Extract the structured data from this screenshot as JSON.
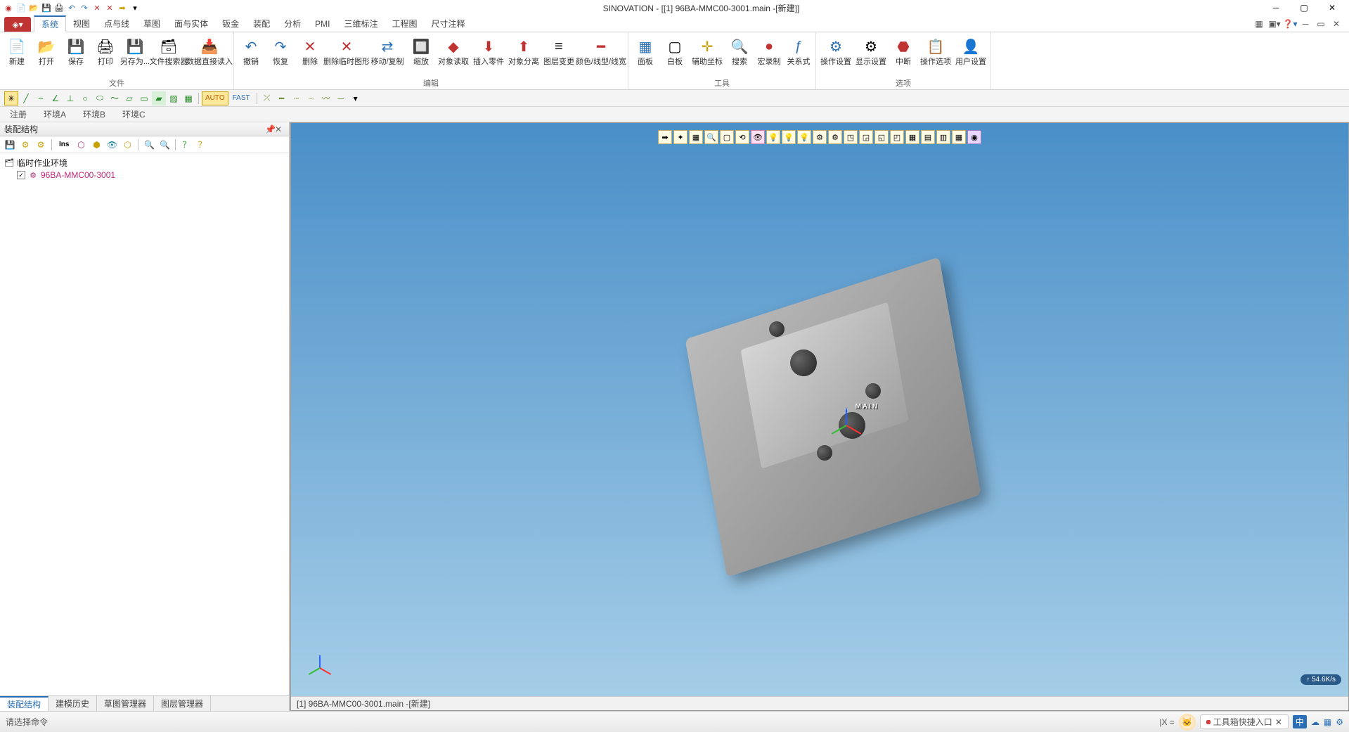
{
  "app": {
    "title": "SINOVATION - [[1] 96BA-MMC00-3001.main -[新建]]"
  },
  "qat": [
    "new",
    "open",
    "save",
    "undo",
    "redo",
    "cut",
    "copy",
    "paste",
    "arrow",
    "more"
  ],
  "ribbon": {
    "tabs": [
      "系统",
      "视图",
      "点与线",
      "草图",
      "面与实体",
      "钣金",
      "装配",
      "分析",
      "PMI",
      "三维标注",
      "工程图",
      "尺寸注释"
    ],
    "active_tab": "系统",
    "groups": {
      "file": {
        "label": "文件",
        "items": [
          {
            "id": "new",
            "label": "新建",
            "icon": "📄"
          },
          {
            "id": "open",
            "label": "打开",
            "icon": "📂"
          },
          {
            "id": "save",
            "label": "保存",
            "icon": "💾"
          },
          {
            "id": "print",
            "label": "打印",
            "icon": "🖨"
          },
          {
            "id": "saveas",
            "label": "另存为...",
            "icon": "💾"
          },
          {
            "id": "filesearch",
            "label": "文件搜索器",
            "icon": "🔍"
          },
          {
            "id": "dataread",
            "label": "数据直接读入",
            "icon": "📥"
          }
        ]
      },
      "edit": {
        "label": "编辑",
        "items": [
          {
            "id": "undo",
            "label": "撤销",
            "icon": "↶"
          },
          {
            "id": "redo",
            "label": "恢复",
            "icon": "↷"
          },
          {
            "id": "delete",
            "label": "删除",
            "icon": "✕"
          },
          {
            "id": "deltemp",
            "label": "删除临时图形",
            "icon": "✕"
          },
          {
            "id": "movecopy",
            "label": "移动/复制",
            "icon": "⇄"
          },
          {
            "id": "zoom",
            "label": "缩放",
            "icon": "🔲"
          },
          {
            "id": "objread",
            "label": "对象读取",
            "icon": "◆"
          },
          {
            "id": "insertpart",
            "label": "插入零件",
            "icon": "⬇"
          },
          {
            "id": "objsep",
            "label": "对象分离",
            "icon": "⬆"
          },
          {
            "id": "layerchg",
            "label": "图层变更",
            "icon": "≡"
          },
          {
            "id": "color",
            "label": "颜色/线型/线宽",
            "icon": "━"
          }
        ]
      },
      "tools": {
        "label": "工具",
        "items": [
          {
            "id": "panel",
            "label": "面板",
            "icon": "▦"
          },
          {
            "id": "white",
            "label": "白板",
            "icon": "▢"
          },
          {
            "id": "auxcoord",
            "label": "辅助坐标",
            "icon": "✛"
          },
          {
            "id": "search",
            "label": "搜索",
            "icon": "🔍"
          },
          {
            "id": "macro",
            "label": "宏录制",
            "icon": "●"
          },
          {
            "id": "relation",
            "label": "关系式",
            "icon": "ƒ"
          }
        ]
      },
      "options": {
        "label": "选项",
        "items": [
          {
            "id": "opset",
            "label": "操作设置",
            "icon": "⚙"
          },
          {
            "id": "dispset",
            "label": "显示设置",
            "icon": "⚙"
          },
          {
            "id": "stop",
            "label": "中断",
            "icon": "⬣"
          },
          {
            "id": "opopt",
            "label": "操作选项",
            "icon": "📋"
          },
          {
            "id": "userset",
            "label": "用户设置",
            "icon": "👤"
          }
        ]
      }
    }
  },
  "secondary_toolbar_badges": {
    "auto": "AUTO",
    "fast": "FAST"
  },
  "context_tabs": [
    "注册",
    "环境A",
    "环境B",
    "环境C"
  ],
  "side_panel": {
    "title": "装配结构",
    "toolbar": [
      "save",
      "cog1",
      "cog2",
      "ins",
      "d1",
      "d2",
      "eye",
      "d3",
      "sep",
      "find1",
      "find2",
      "sep",
      "help",
      "q"
    ],
    "tree": {
      "root": {
        "label": "临时作业环境",
        "icon": "🗂"
      },
      "child": {
        "label": "96BA-MMC00-3001",
        "checked": true
      }
    },
    "tabs": [
      "装配结构",
      "建模历史",
      "草图管理器",
      "图层管理器"
    ],
    "active_tab": "装配结构"
  },
  "viewport": {
    "toolbar_count": 23,
    "axis_label": "MAIN",
    "footer": "[1] 96BA-MMC00-3001.main -[新建]"
  },
  "statusbar": {
    "prompt": "请选择命令",
    "coord_prefix": "|X =",
    "toolbox_label": "工具箱快捷入口",
    "ime": "中",
    "speed": "↑ 54.6K/s"
  }
}
